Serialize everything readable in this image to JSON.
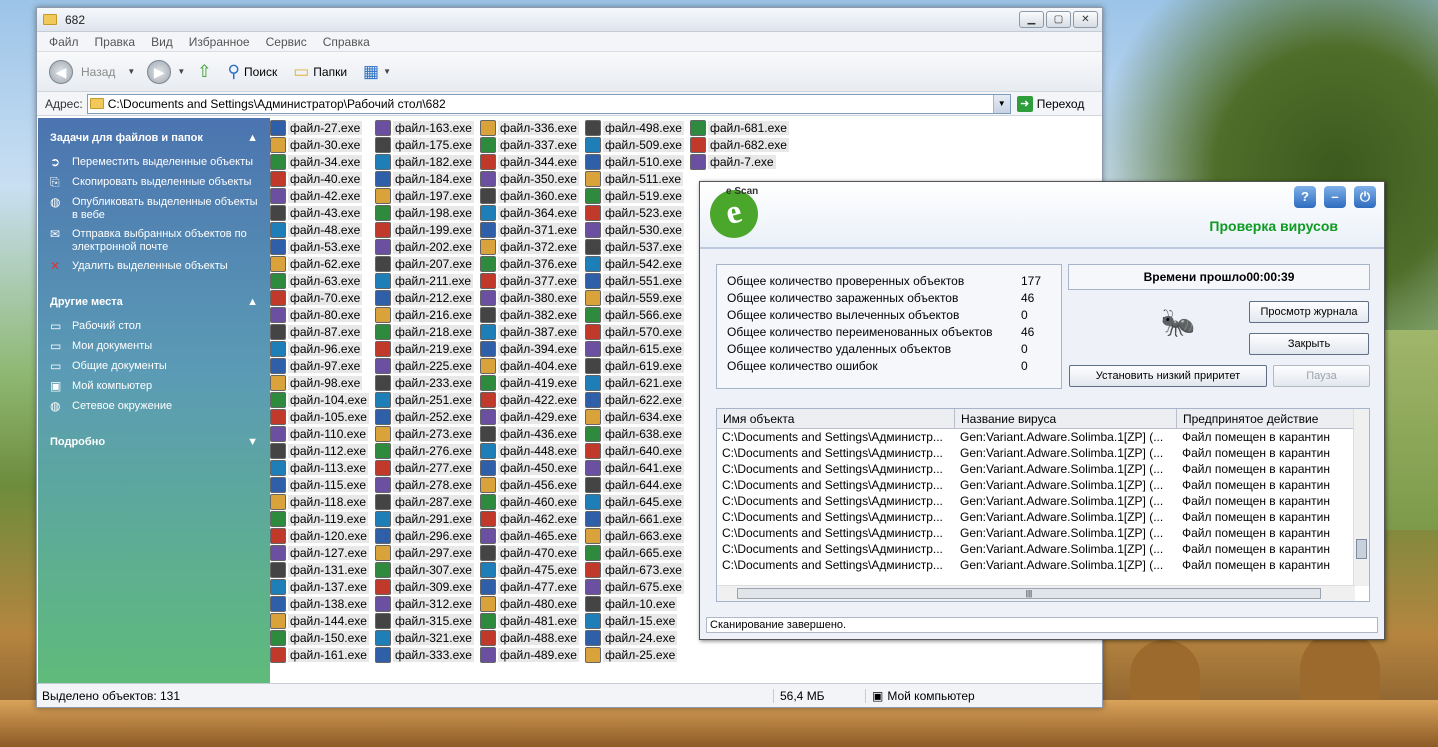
{
  "explorer": {
    "title": "682",
    "menu": [
      "Файл",
      "Правка",
      "Вид",
      "Избранное",
      "Сервис",
      "Справка"
    ],
    "toolbar": {
      "back": "Назад",
      "search": "Поиск",
      "folders": "Папки"
    },
    "address": {
      "label": "Адрес:",
      "path": "C:\\Documents and Settings\\Администратор\\Рабочий стол\\682",
      "go": "Переход"
    },
    "tasks": {
      "title": "Задачи для файлов и папок",
      "items": [
        "Переместить выделенные объекты",
        "Скопировать выделенные объекты",
        "Опубликовать выделенные объекты в вебе",
        "Отправка выбранных объектов по электронной почте",
        "Удалить выделенные объекты"
      ]
    },
    "places": {
      "title": "Другие места",
      "items": [
        "Рабочий стол",
        "Мои документы",
        "Общие документы",
        "Мой компьютер",
        "Сетевое окружение"
      ]
    },
    "details": {
      "title": "Подробно"
    },
    "files": [
      "файл-27.exe",
      "файл-30.exe",
      "файл-34.exe",
      "файл-40.exe",
      "файл-42.exe",
      "файл-43.exe",
      "файл-48.exe",
      "файл-53.exe",
      "файл-62.exe",
      "файл-63.exe",
      "файл-70.exe",
      "файл-80.exe",
      "файл-87.exe",
      "файл-96.exe",
      "файл-97.exe",
      "файл-98.exe",
      "файл-104.exe",
      "файл-105.exe",
      "файл-110.exe",
      "файл-112.exe",
      "файл-113.exe",
      "файл-115.exe",
      "файл-118.exe",
      "файл-119.exe",
      "файл-120.exe",
      "файл-127.exe",
      "файл-131.exe",
      "файл-137.exe",
      "файл-138.exe",
      "файл-144.exe",
      "файл-150.exe",
      "файл-161.exe",
      "файл-163.exe",
      "файл-175.exe",
      "файл-182.exe",
      "файл-184.exe",
      "файл-197.exe",
      "файл-198.exe",
      "файл-199.exe",
      "файл-202.exe",
      "файл-207.exe",
      "файл-211.exe",
      "файл-212.exe",
      "файл-216.exe",
      "файл-218.exe",
      "файл-219.exe",
      "файл-225.exe",
      "файл-233.exe",
      "файл-251.exe",
      "файл-252.exe",
      "файл-273.exe",
      "файл-276.exe",
      "файл-277.exe",
      "файл-278.exe",
      "файл-287.exe",
      "файл-291.exe",
      "файл-296.exe",
      "файл-297.exe",
      "файл-307.exe",
      "файл-309.exe",
      "файл-312.exe",
      "файл-315.exe",
      "файл-321.exe",
      "файл-333.exe",
      "файл-336.exe",
      "файл-337.exe",
      "файл-344.exe",
      "файл-350.exe",
      "файл-360.exe",
      "файл-364.exe",
      "файл-371.exe",
      "файл-372.exe",
      "файл-376.exe",
      "файл-377.exe",
      "файл-380.exe",
      "файл-382.exe",
      "файл-387.exe",
      "файл-394.exe",
      "файл-404.exe",
      "файл-419.exe",
      "файл-422.exe",
      "файл-429.exe",
      "файл-436.exe",
      "файл-448.exe",
      "файл-450.exe",
      "файл-456.exe",
      "файл-460.exe",
      "файл-462.exe",
      "файл-465.exe",
      "файл-470.exe",
      "файл-475.exe",
      "файл-477.exe",
      "файл-480.exe",
      "файл-481.exe",
      "файл-488.exe",
      "файл-489.exe",
      "файл-498.exe",
      "файл-509.exe",
      "файл-510.exe",
      "файл-511.exe",
      "файл-519.exe",
      "файл-523.exe",
      "файл-530.exe",
      "файл-537.exe",
      "файл-542.exe",
      "файл-551.exe",
      "файл-559.exe",
      "файл-566.exe",
      "файл-570.exe",
      "файл-615.exe",
      "файл-619.exe",
      "файл-621.exe",
      "файл-622.exe",
      "файл-634.exe",
      "файл-638.exe",
      "файл-640.exe",
      "файл-641.exe",
      "файл-644.exe",
      "файл-645.exe",
      "файл-661.exe",
      "файл-663.exe",
      "файл-665.exe",
      "файл-673.exe",
      "файл-675.exe",
      "файл-10.exe",
      "файл-15.exe",
      "файл-24.exe",
      "файл-25.exe",
      "файл-681.exe",
      "файл-682.exe",
      "файл-7.exe"
    ],
    "status": {
      "selected": "Выделено объектов: 131",
      "size": "56,4 МБ",
      "location": "Мой компьютер"
    }
  },
  "escan": {
    "brand": "e Scan",
    "title": "Проверка вирусов",
    "stats": [
      {
        "label": "Общее количество проверенных объектов",
        "value": "177"
      },
      {
        "label": "Общее количество зараженных объектов",
        "value": "46"
      },
      {
        "label": "Общее количество вылеченных объектов",
        "value": "0"
      },
      {
        "label": "Общее количество переименованных объектов",
        "value": "46"
      },
      {
        "label": "Общее количество удаленных объектов",
        "value": "0"
      },
      {
        "label": "Общее количество ошибок",
        "value": "0"
      }
    ],
    "timer": "Времени прошло00:00:39",
    "buttons": {
      "log": "Просмотр журнала",
      "close": "Закрыть",
      "low_priority": "Установить низкий приритет",
      "pause": "Пауза"
    },
    "columns": [
      "Имя объекта",
      "Название вируса",
      "Предпринятое действие"
    ],
    "rows": [
      [
        "C:\\Documents and Settings\\Администр...",
        "Gen:Variant.Adware.Solimba.1[ZP] (...",
        "Файл помещен в карантин"
      ],
      [
        "C:\\Documents and Settings\\Администр...",
        "Gen:Variant.Adware.Solimba.1[ZP] (...",
        "Файл помещен в карантин"
      ],
      [
        "C:\\Documents and Settings\\Администр...",
        "Gen:Variant.Adware.Solimba.1[ZP] (...",
        "Файл помещен в карантин"
      ],
      [
        "C:\\Documents and Settings\\Администр...",
        "Gen:Variant.Adware.Solimba.1[ZP] (...",
        "Файл помещен в карантин"
      ],
      [
        "C:\\Documents and Settings\\Администр...",
        "Gen:Variant.Adware.Solimba.1[ZP] (...",
        "Файл помещен в карантин"
      ],
      [
        "C:\\Documents and Settings\\Администр...",
        "Gen:Variant.Adware.Solimba.1[ZP] (...",
        "Файл помещен в карантин"
      ],
      [
        "C:\\Documents and Settings\\Администр...",
        "Gen:Variant.Adware.Solimba.1[ZP] (...",
        "Файл помещен в карантин"
      ],
      [
        "C:\\Documents and Settings\\Администр...",
        "Gen:Variant.Adware.Solimba.1[ZP] (...",
        "Файл помещен в карантин"
      ],
      [
        "C:\\Documents and Settings\\Администр...",
        "Gen:Variant.Adware.Solimba.1[ZP] (...",
        "Файл помещен в карантин"
      ]
    ],
    "status": "Сканирование завершено."
  }
}
